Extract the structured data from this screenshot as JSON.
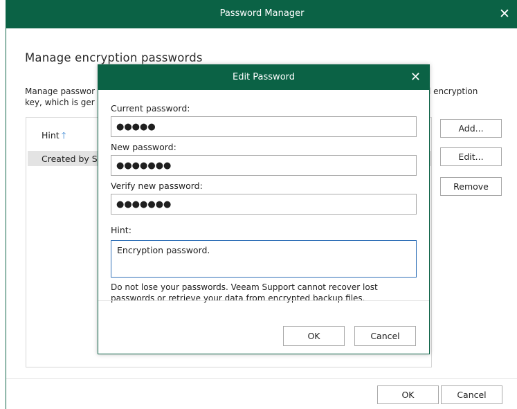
{
  "window": {
    "title": "Password Manager",
    "close": "✕",
    "heading": "Manage encryption passwords",
    "description_left_line1": "Manage passwor",
    "description_left_line2": "key, which is ger",
    "description_right": "l encryption",
    "list": {
      "column_header": "Hint",
      "sort_glyph": "🡑",
      "rows": [
        "Created by Sl"
      ]
    },
    "buttons": {
      "add": "Add...",
      "edit": "Edit...",
      "remove": "Remove"
    },
    "footer": {
      "ok": "OK",
      "cancel": "Cancel"
    }
  },
  "dialog": {
    "title": "Edit Password",
    "close": "✕",
    "current_password_label": "Current password:",
    "current_password_value": "●●●●●",
    "new_password_label": "New password:",
    "new_password_value": "●●●●●●●",
    "verify_password_label": "Verify new password:",
    "verify_password_value": "●●●●●●●",
    "hint_label": "Hint:",
    "hint_value": "Encryption password.",
    "note": "Do not lose your passwords. Veeam Support cannot recover lost passwords or retrieve your data from encrypted backup files.",
    "ok": "OK",
    "cancel": "Cancel"
  },
  "colors": {
    "title_bar": "#0b6245",
    "focus_border": "#2f6fb7",
    "sort_arrow": "#2f7fd1"
  }
}
